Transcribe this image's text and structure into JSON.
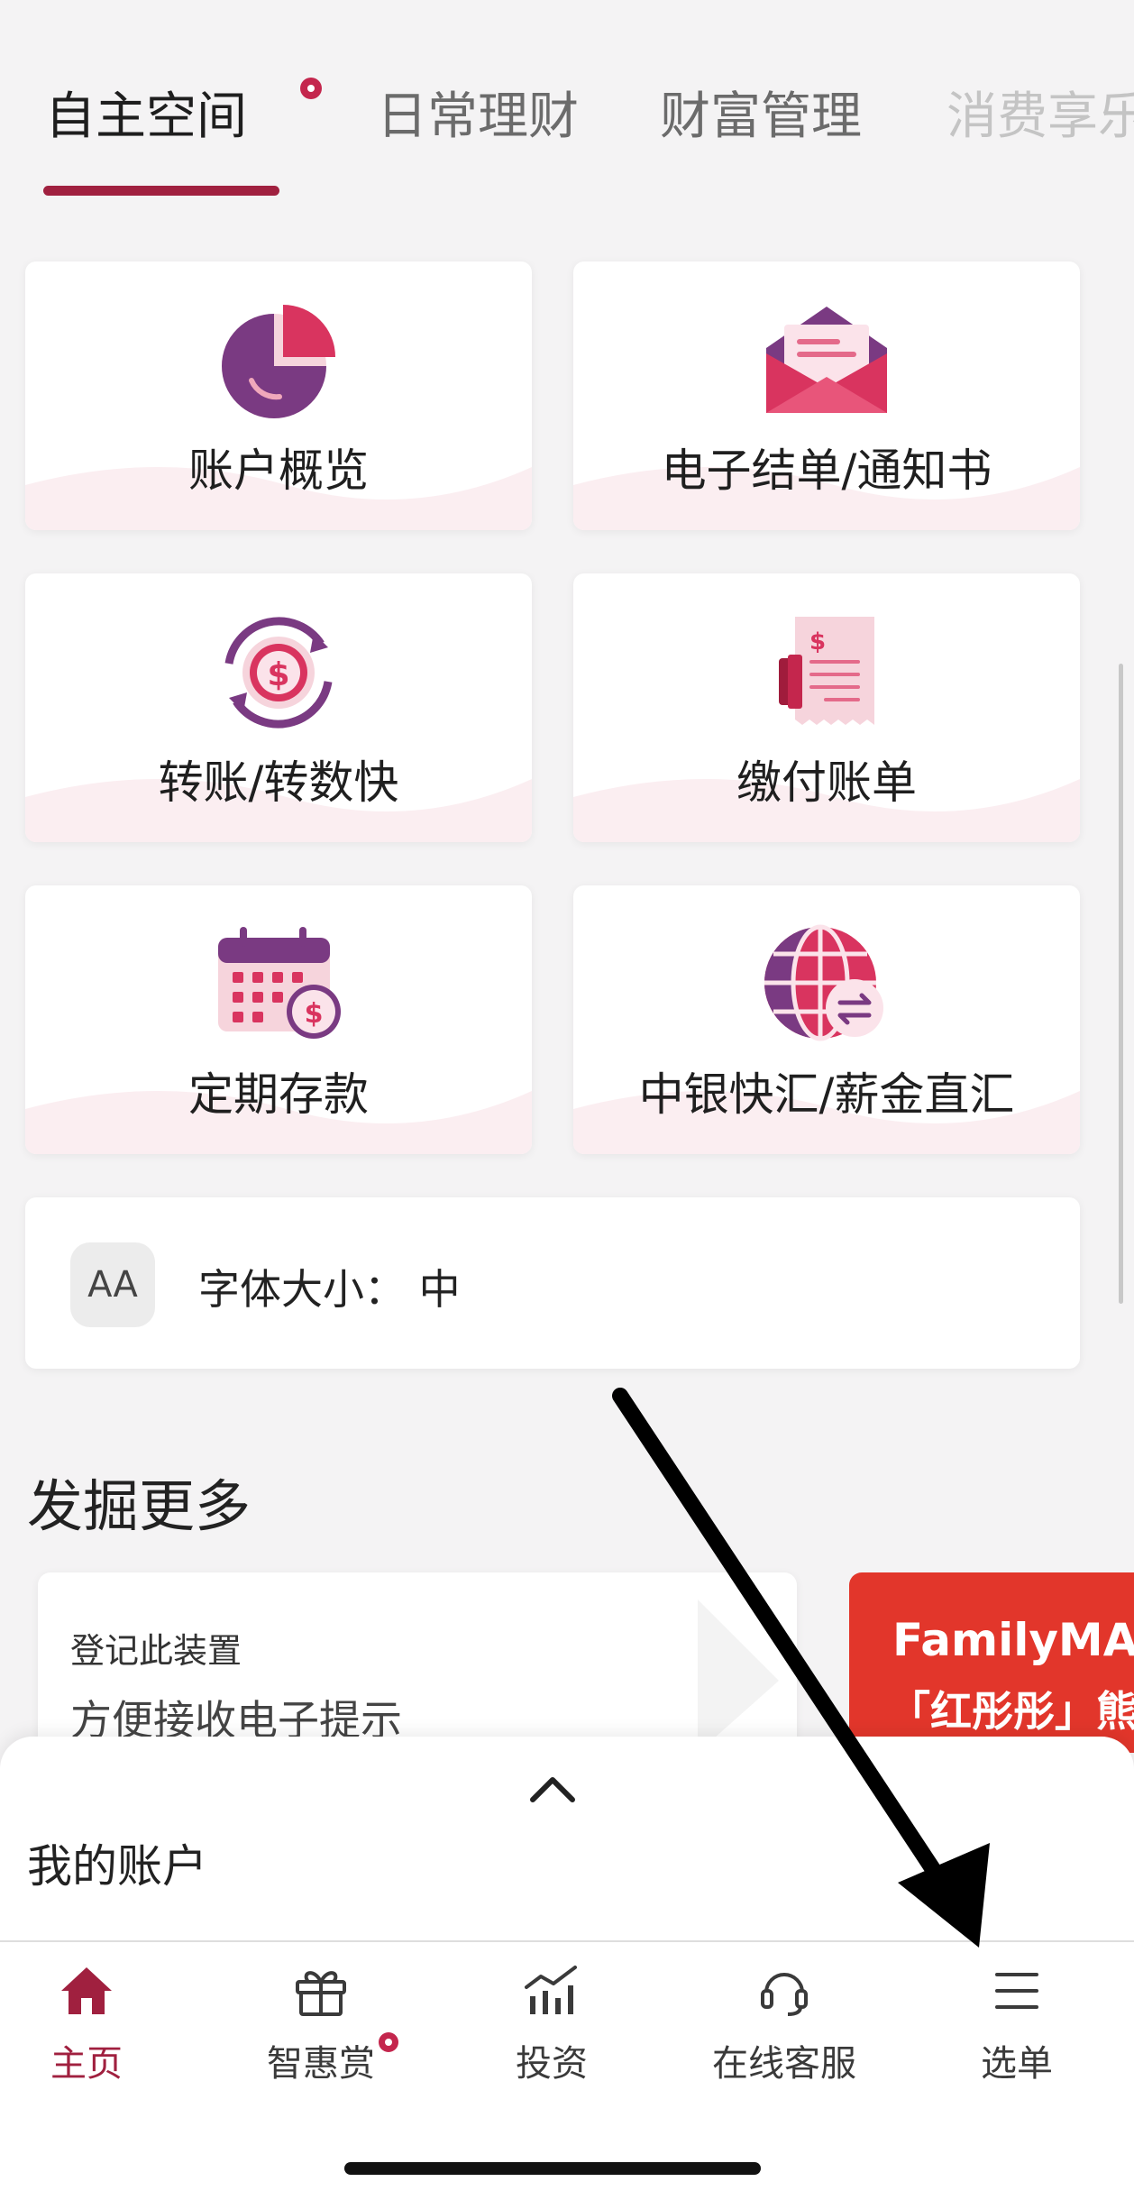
{
  "tabs": [
    {
      "label": "自主空间",
      "active": true,
      "has_dot": true
    },
    {
      "label": "日常理财",
      "active": false
    },
    {
      "label": "财富管理",
      "active": false
    },
    {
      "label": "消费享乐",
      "active": false
    }
  ],
  "tiles": [
    {
      "label": "账户概览",
      "icon": "pie-chart-icon"
    },
    {
      "label": "电子结单/通知书",
      "icon": "envelope-icon"
    },
    {
      "label": "转账/转数快",
      "icon": "dollar-transfer-icon"
    },
    {
      "label": "缴付账单",
      "icon": "bill-receipt-icon"
    },
    {
      "label": "定期存款",
      "icon": "calendar-dollar-icon"
    },
    {
      "label": "中银快汇/薪金直汇",
      "icon": "globe-exchange-icon"
    }
  ],
  "font_size": {
    "icon_text": "AA",
    "label": "字体大小：  中"
  },
  "discover": {
    "title": "发掘更多",
    "cards": [
      {
        "title": "登记此装置",
        "subtitle": "方便接收电子提示"
      },
      {
        "line1": "FamilyMAX",
        "line2": "「红彤彤」熊猫"
      }
    ]
  },
  "sheet": {
    "title": "我的账户"
  },
  "bottom_nav": [
    {
      "label": "主页",
      "icon": "home-icon",
      "active": true
    },
    {
      "label": "智惠赏",
      "icon": "gift-icon",
      "has_dot": true
    },
    {
      "label": "投资",
      "icon": "investment-chart-icon"
    },
    {
      "label": "在线客服",
      "icon": "headset-icon"
    },
    {
      "label": "选单",
      "icon": "hamburger-menu-icon"
    }
  ],
  "colors": {
    "accent": "#a0203f",
    "brand_pink": "#d9345f",
    "brand_purple": "#7a3a82",
    "promo_red": "#e2362b"
  }
}
